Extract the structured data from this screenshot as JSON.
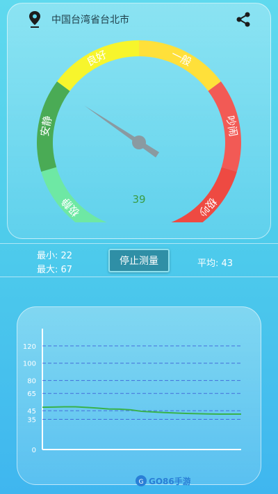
{
  "header": {
    "location": "中国台湾省台北市"
  },
  "gauge": {
    "zones": [
      {
        "label": "极静",
        "color": "#6ee8a4"
      },
      {
        "label": "安静",
        "color": "#4aab55"
      },
      {
        "label": "良好",
        "color": "#f7f52c"
      },
      {
        "label": "一般",
        "color": "#ffe03a"
      },
      {
        "label": "吵闹",
        "color": "#f25a55"
      },
      {
        "label": "极吵",
        "color": "#ee4a42"
      }
    ],
    "value": 39,
    "display": "39"
  },
  "stats": {
    "min": "最小: 22",
    "max": "最大: 67",
    "avg": "平均: 43",
    "stop_button": "停止测量"
  },
  "chart_data": {
    "type": "line",
    "ytick_labels": [
      "120",
      "100",
      "80",
      "65",
      "45",
      "35",
      "0"
    ],
    "y_ticks": [
      120,
      100,
      80,
      65,
      45,
      35,
      0
    ],
    "ylim": [
      0,
      140
    ],
    "series": [
      {
        "values": [
          49,
          49.2,
          49.5,
          49.5,
          48.8,
          48,
          47,
          46.8,
          46,
          44.2,
          43.5,
          42.8,
          42.3,
          41.8,
          41.5,
          41.2,
          41,
          41,
          41
        ]
      }
    ],
    "line_color": "#38b24a",
    "grid_color": "#3d5fd6"
  },
  "watermark": {
    "text": "GO86手游网"
  }
}
